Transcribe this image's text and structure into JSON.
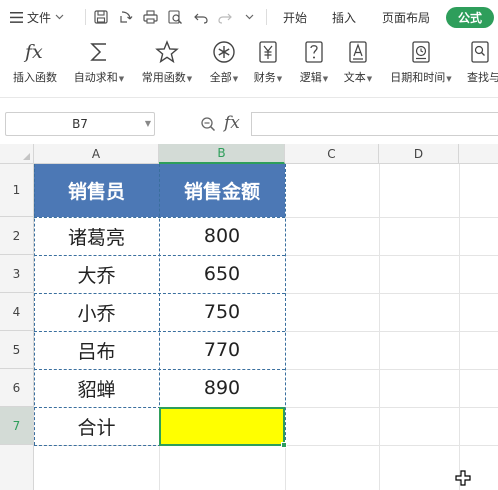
{
  "menubar": {
    "file_label": "文件",
    "tabs": [
      "开始",
      "插入",
      "页面布局",
      "公式"
    ],
    "active_tab": "公式"
  },
  "ribbon": {
    "items": [
      {
        "label": "插入函数",
        "icon": "fx-icon"
      },
      {
        "label": "自动求和",
        "icon": "sigma-icon",
        "dropdown": true
      },
      {
        "label": "常用函数",
        "icon": "star-icon",
        "dropdown": true
      },
      {
        "label": "全部",
        "icon": "asterisk-circle-icon",
        "dropdown": true
      },
      {
        "label": "财务",
        "icon": "finance-icon",
        "dropdown": true
      },
      {
        "label": "逻辑",
        "icon": "logic-icon",
        "dropdown": true
      },
      {
        "label": "文本",
        "icon": "text-icon",
        "dropdown": true
      },
      {
        "label": "日期和时间",
        "icon": "clock-icon",
        "dropdown": true
      },
      {
        "label": "查找与",
        "icon": "lookup-icon"
      }
    ]
  },
  "formula_bar": {
    "name_box": "B7",
    "fx_label": "fx",
    "formula": ""
  },
  "sheet": {
    "columns": [
      "A",
      "B",
      "C",
      "D"
    ],
    "selected_column": "B",
    "rows": [
      "1",
      "2",
      "3",
      "4",
      "5",
      "6",
      "7"
    ],
    "selected_row": "7",
    "header": [
      "销售员",
      "销售金额"
    ],
    "data": [
      [
        "诸葛亮",
        "800"
      ],
      [
        "大乔",
        "650"
      ],
      [
        "小乔",
        "750"
      ],
      [
        "吕布",
        "770"
      ],
      [
        "貂蝉",
        "890"
      ],
      [
        "合计",
        ""
      ]
    ],
    "active_cell": "B7",
    "header_fill": "#4c78b5",
    "active_fill": "#ffff00",
    "accent": "#2e9e5b"
  }
}
